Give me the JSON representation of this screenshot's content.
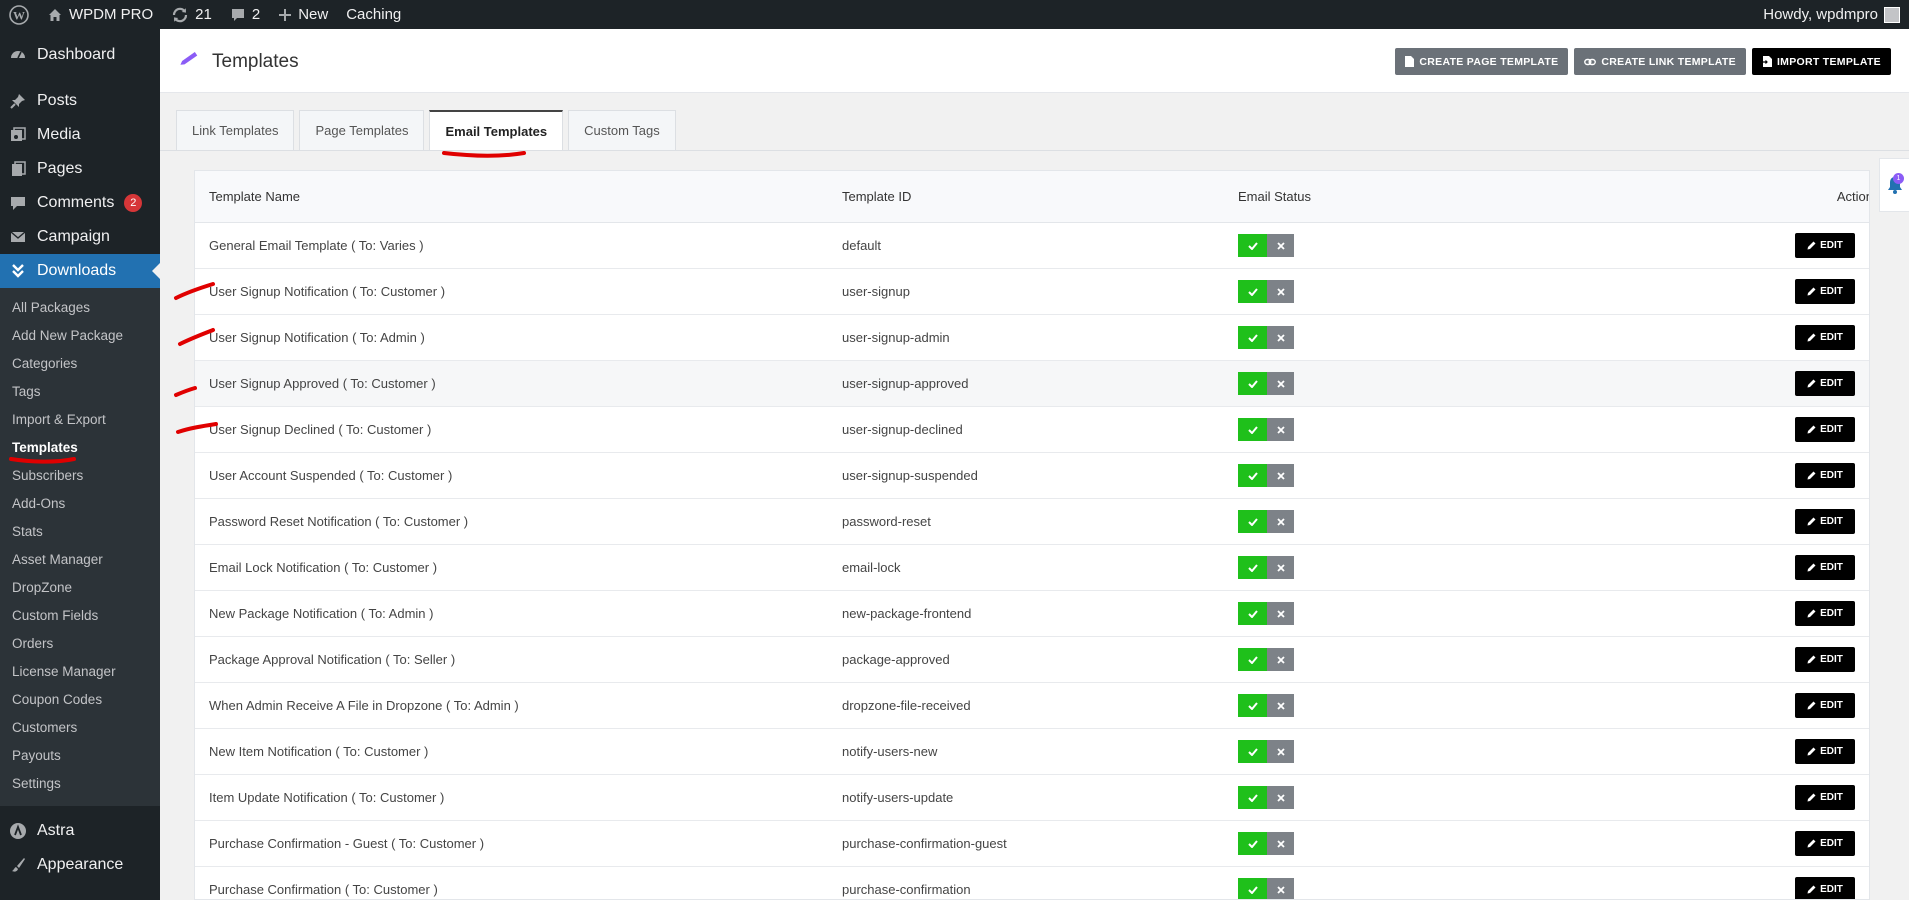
{
  "admin_bar": {
    "site_name": "WPDM PRO",
    "updates_count": "21",
    "comments_count": "2",
    "new_label": "New",
    "caching_label": "Caching",
    "greeting": "Howdy, wpdmpro"
  },
  "sidebar": {
    "dashboard": "Dashboard",
    "posts": "Posts",
    "media": "Media",
    "pages": "Pages",
    "comments": "Comments",
    "comments_badge": "2",
    "campaign": "Campaign",
    "downloads": "Downloads",
    "submenu": [
      "All Packages",
      "Add New Package",
      "Categories",
      "Tags",
      "Import & Export",
      "Templates",
      "Subscribers",
      "Add-Ons",
      "Stats",
      "Asset Manager",
      "DropZone",
      "Custom Fields",
      "Orders",
      "License Manager",
      "Coupon Codes",
      "Customers",
      "Payouts",
      "Settings"
    ],
    "astra": "Astra",
    "appearance": "Appearance"
  },
  "header": {
    "title": "Templates",
    "btn_create_page": "CREATE PAGE TEMPLATE",
    "btn_create_link": "CREATE LINK TEMPLATE",
    "btn_import": "IMPORT TEMPLATE"
  },
  "tabs": [
    "Link Templates",
    "Page Templates",
    "Email Templates",
    "Custom Tags"
  ],
  "table": {
    "headers": {
      "name": "Template Name",
      "id": "Template ID",
      "status": "Email Status",
      "action": "Action"
    },
    "edit_label": "EDIT",
    "rows": [
      {
        "name": "General Email Template ( To: Varies )",
        "id": "default"
      },
      {
        "name": "User Signup Notification ( To: Customer )",
        "id": "user-signup"
      },
      {
        "name": "User Signup Notification ( To: Admin )",
        "id": "user-signup-admin"
      },
      {
        "name": "User Signup Approved ( To: Customer )",
        "id": "user-signup-approved"
      },
      {
        "name": "User Signup Declined ( To: Customer )",
        "id": "user-signup-declined"
      },
      {
        "name": "User Account Suspended ( To: Customer )",
        "id": "user-signup-suspended"
      },
      {
        "name": "Password Reset Notification ( To: Customer )",
        "id": "password-reset"
      },
      {
        "name": "Email Lock Notification ( To: Customer )",
        "id": "email-lock"
      },
      {
        "name": "New Package Notification ( To: Admin )",
        "id": "new-package-frontend"
      },
      {
        "name": "Package Approval Notification ( To: Seller )",
        "id": "package-approved"
      },
      {
        "name": "When Admin Receive A File in Dropzone ( To: Admin )",
        "id": "dropzone-file-received"
      },
      {
        "name": "New Item Notification ( To: Customer )",
        "id": "notify-users-new"
      },
      {
        "name": "Item Update Notification ( To: Customer )",
        "id": "notify-users-update"
      },
      {
        "name": "Purchase Confirmation - Guest ( To: Customer )",
        "id": "purchase-confirmation-guest"
      },
      {
        "name": "Purchase Confirmation ( To: Customer )",
        "id": "purchase-confirmation"
      }
    ]
  },
  "notification": {
    "count": "1"
  },
  "colors": {
    "accent": "#2271b1",
    "status_on": "#1fc01b",
    "status_off": "#7d8288",
    "annotation": "#e00000"
  }
}
